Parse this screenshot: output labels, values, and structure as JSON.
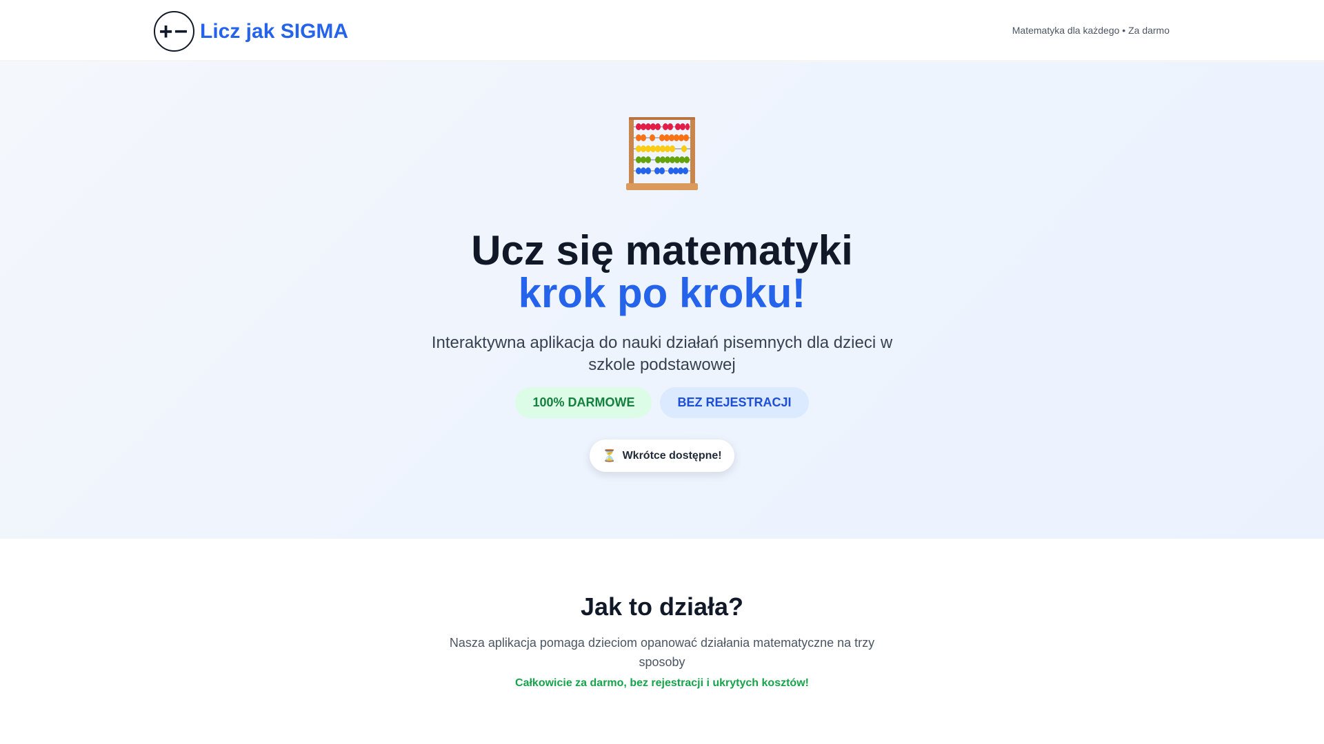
{
  "header": {
    "logo_symbol": "+−",
    "logo_text": "Licz jak SIGMA",
    "tagline": "Matematyka dla każdego • Za darmo"
  },
  "hero": {
    "icon": "abacus-icon",
    "title_line1": "Ucz się matematyki",
    "title_line2": "krok po kroku!",
    "subtitle": "Interaktywna aplikacja do nauki działań pisemnych dla dzieci w szkole podstawowej",
    "badges": [
      {
        "label": "100% DARMOWE",
        "color": "#15803d"
      },
      {
        "label": "BEZ REJESTRACJI",
        "color": "#1d4ed8"
      }
    ],
    "cta_icon": "⏳",
    "cta_label": "Wkrótce dostępne!"
  },
  "how": {
    "title": "Jak to działa?",
    "description": "Nasza aplikacja pomaga dzieciom opanować działania matematyczne na trzy sposoby",
    "free_note": "Całkowicie za darmo, bez rejestracji i ukrytych kosztów!"
  },
  "colors": {
    "brand_blue": "#2563eb",
    "green": "#16a34a",
    "dark": "#111827"
  }
}
